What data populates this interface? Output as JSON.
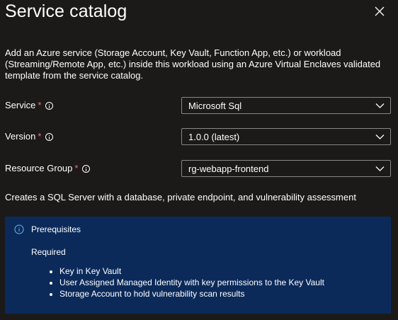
{
  "header": {
    "title": "Service catalog",
    "close_icon": "close-icon"
  },
  "description": "Add an Azure service (Storage Account, Key Vault, Function App, etc.) or workload (Streaming/Remote App, etc.) inside this workload using an Azure Virtual Enclaves validated template from the service catalog.",
  "form": {
    "service": {
      "label": "Service",
      "required": "*",
      "value": "Microsoft Sql"
    },
    "version": {
      "label": "Version",
      "required": "*",
      "value": "1.0.0 (latest)"
    },
    "resource_group": {
      "label": "Resource Group",
      "required": "*",
      "value": "rg-webapp-frontend"
    }
  },
  "service_note": "Creates a SQL Server with a database, private endpoint, and vulnerability assessment",
  "prerequisites": {
    "title": "Prerequisites",
    "subtitle": "Required",
    "items": [
      "Key in Key Vault",
      "User Assigned Managed Identity with key permissions to the Key Vault",
      "Storage Account to hold vulnerability scan results"
    ]
  },
  "colors": {
    "background": "#1b1a19",
    "info_panel": "#0b2a5a",
    "required": "#f1707b",
    "border": "#8a8886"
  }
}
